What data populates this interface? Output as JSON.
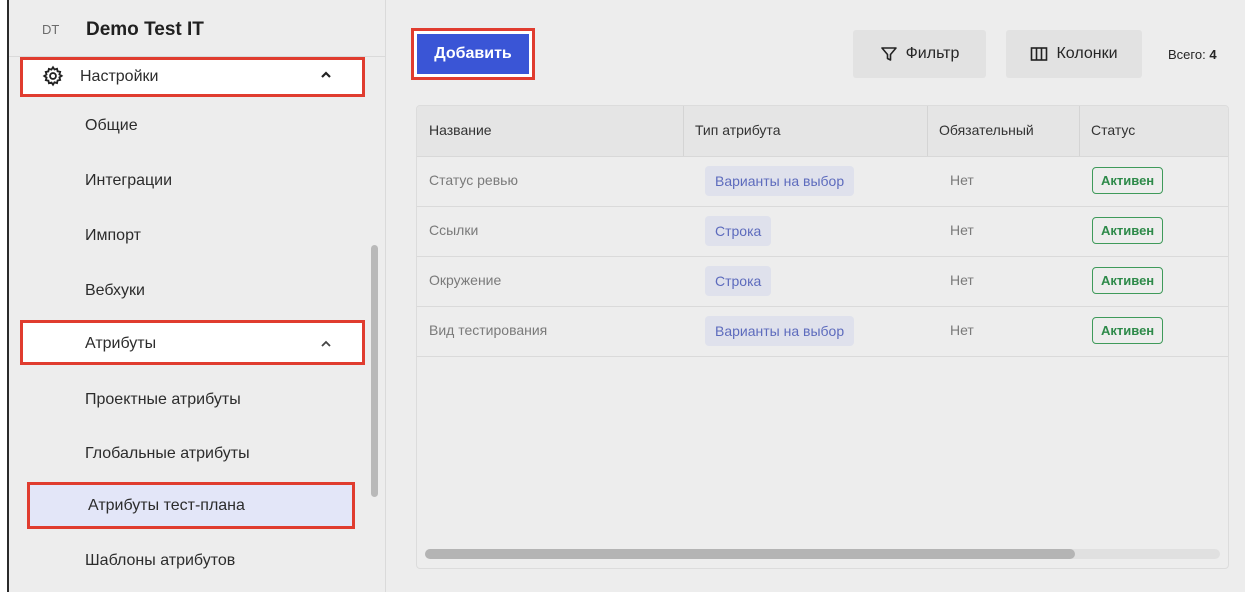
{
  "sidebar": {
    "avatar_initials": "DT",
    "project_title": "Demo Test IT",
    "settings_label": "Настройки",
    "items": [
      {
        "label": "Общие"
      },
      {
        "label": "Интеграции"
      },
      {
        "label": "Импорт"
      },
      {
        "label": "Вебхуки"
      }
    ],
    "attributes_label": "Атрибуты",
    "attr_items": [
      {
        "label": "Проектные атрибуты"
      },
      {
        "label": "Глобальные атрибуты"
      },
      {
        "label": "Атрибуты тест-плана"
      },
      {
        "label": "Шаблоны атрибутов"
      }
    ]
  },
  "toolbar": {
    "add_label": "Добавить",
    "filter_label": "Фильтр",
    "columns_label": "Колонки",
    "total_label": "Всего:",
    "total_value": "4"
  },
  "table": {
    "headers": [
      "Название",
      "Тип атрибута",
      "Обязательный",
      "Статус"
    ],
    "rows": [
      {
        "name": "Статус ревью",
        "type": "Варианты на выбор",
        "required": "Нет",
        "status": "Активен"
      },
      {
        "name": "Ссылки",
        "type": "Строка",
        "required": "Нет",
        "status": "Активен"
      },
      {
        "name": "Окружение",
        "type": "Строка",
        "required": "Нет",
        "status": "Активен"
      },
      {
        "name": "Вид тестирования",
        "type": "Варианты на выбор",
        "required": "Нет",
        "status": "Активен"
      }
    ]
  },
  "colors": {
    "accent": "#3a55d6",
    "highlight_border": "#e03c2f",
    "active_green": "#2e8a4a",
    "chip_text": "#5d6bbd"
  }
}
